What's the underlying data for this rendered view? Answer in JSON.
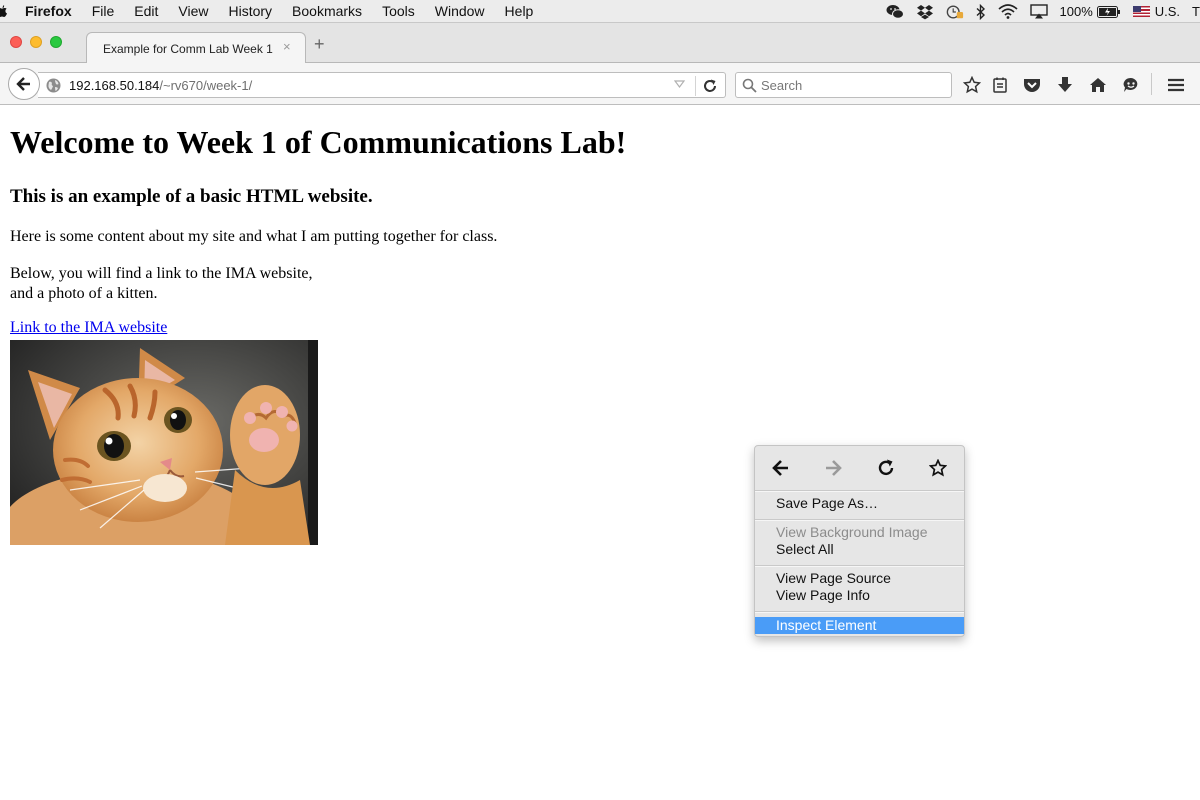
{
  "menubar": {
    "items": [
      "Firefox",
      "File",
      "Edit",
      "View",
      "History",
      "Bookmarks",
      "Tools",
      "Window",
      "Help"
    ],
    "battery": "100%",
    "input_source": "U.S.",
    "clock_fragment": "T"
  },
  "tab": {
    "title": "Example for Comm Lab Week 1",
    "close": "×",
    "new_tab": "+"
  },
  "navbar": {
    "url_host": "192.168.50.184",
    "url_path": "/~rv670/week-1/",
    "search_placeholder": "Search"
  },
  "page": {
    "heading": "Welcome to Week 1 of Communications Lab!",
    "subheading": "This is an example of a basic HTML website.",
    "paragraph1": "Here is some content about my site and what I am putting together for class.",
    "paragraph2_line1": "Below, you will find a link to the IMA website,",
    "paragraph2_line2": "and a photo of a kitten.",
    "link_text": "Link to the IMA website"
  },
  "context_menu": {
    "save_page": "Save Page As…",
    "view_background": "View Background Image",
    "select_all": "Select All",
    "view_source": "View Page Source",
    "view_info": "View Page Info",
    "inspect": "Inspect Element"
  },
  "colors": {
    "highlight": "#4a9cf7",
    "link": "#0000ee"
  }
}
